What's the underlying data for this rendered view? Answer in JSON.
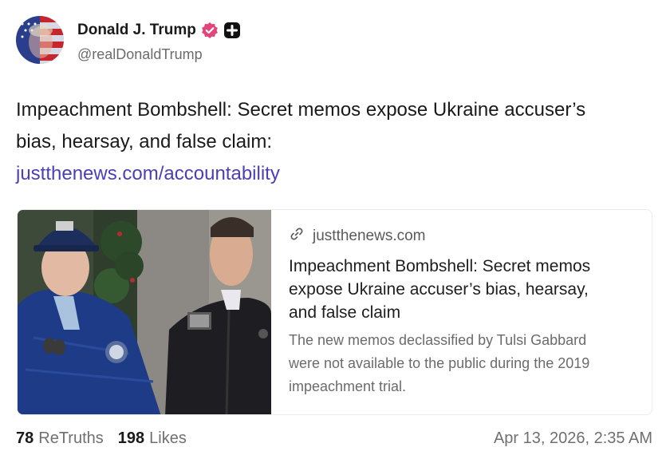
{
  "author": {
    "display_name": "Donald J. Trump",
    "handle": "@realDonaldTrump"
  },
  "post": {
    "text": "Impeachment Bombshell: Secret memos expose Ukraine accuser’s bias, hearsay, and false claim:",
    "link_text": "justthenews.com/accountability"
  },
  "card": {
    "domain": "justthenews.com",
    "title": "Impeachment Bombshell: Secret memos expose Ukraine accuser’s bias, hearsay, and false claim",
    "description": "The new memos declassified by Tulsi Gabbard were not available to the public during the 2019 impeachment trial."
  },
  "stats": {
    "retruths_count": "78",
    "retruths_label": "ReTruths",
    "likes_count": "198",
    "likes_label": "Likes"
  },
  "timestamp": "Apr 13, 2026, 2:35 AM",
  "colors": {
    "link": "#4a3fb8",
    "verified_badge": "#e0457b",
    "muted_text": "#6b6b6b"
  },
  "icons": {
    "verified": "verified-badge-icon",
    "plus": "plus-badge-icon",
    "link": "link-chain-icon"
  }
}
